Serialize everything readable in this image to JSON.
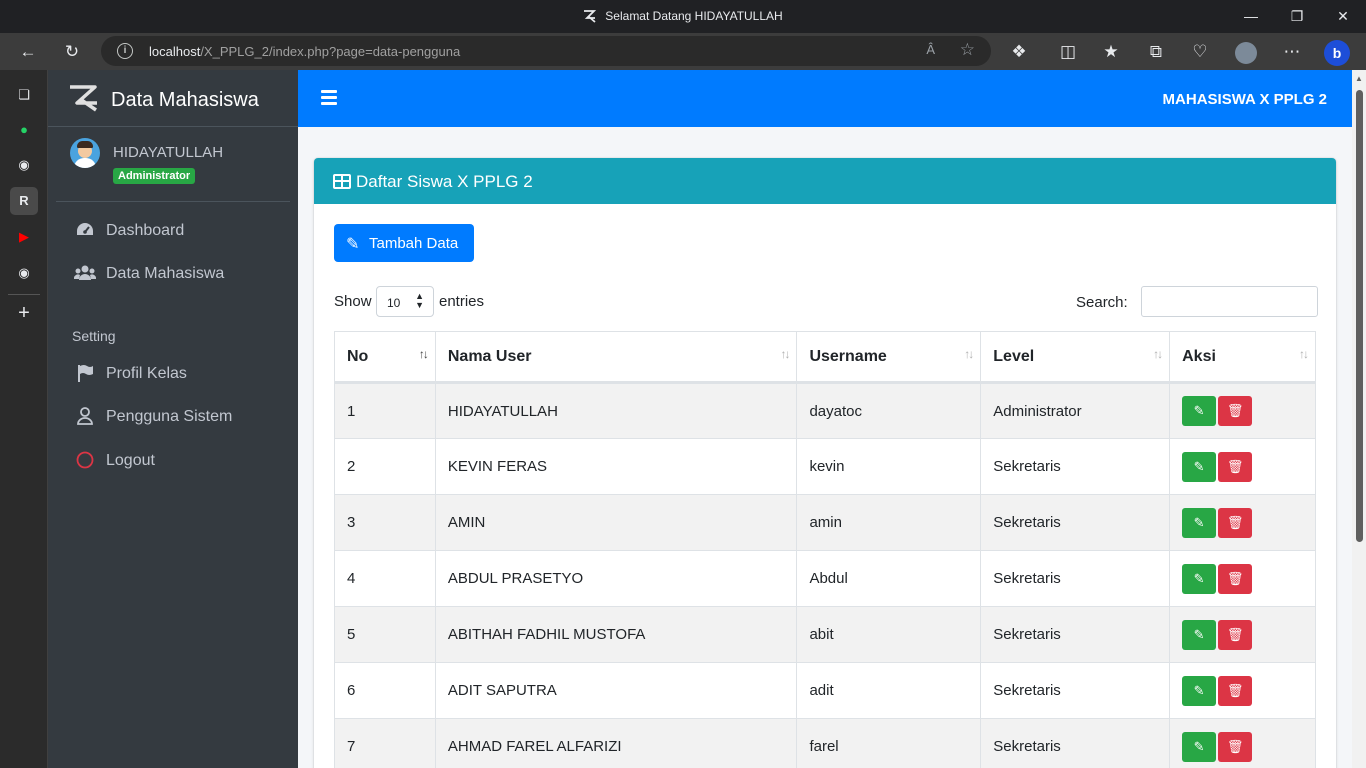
{
  "browser": {
    "window_title": "Selamat Datang HIDAYATULLAH",
    "url_host": "localhost",
    "url_path": "/X_PPLG_2/index.php?page=data-pengguna",
    "read_aloud": "Â"
  },
  "sidebar": {
    "brand": "Data Mahasiswa",
    "user": {
      "name": "HIDAYATULLAH",
      "role": "Administrator"
    },
    "items": [
      {
        "label": "Dashboard",
        "icon": "tachometer-icon"
      },
      {
        "label": "Data Mahasiswa",
        "icon": "users-icon"
      }
    ],
    "section_header": "Setting",
    "setting_items": [
      {
        "label": "Profil Kelas",
        "icon": "flag-icon"
      },
      {
        "label": "Pengguna Sistem",
        "icon": "user-icon"
      },
      {
        "label": "Logout",
        "icon": "power-icon"
      }
    ]
  },
  "navbar": {
    "title": "MAHASISWA X PPLG 2"
  },
  "card": {
    "title": "Daftar Siswa X PPLG 2",
    "add_button": "Tambah Data",
    "show_label": "Show",
    "entries_value": "10",
    "entries_label": "entries",
    "search_label": "Search:",
    "search_value": ""
  },
  "table": {
    "columns": [
      "No",
      "Nama User",
      "Username",
      "Level",
      "Aksi"
    ],
    "rows": [
      {
        "no": "1",
        "nama": "HIDAYATULLAH",
        "username": "dayatoc",
        "level": "Administrator"
      },
      {
        "no": "2",
        "nama": "KEVIN FERAS",
        "username": "kevin",
        "level": "Sekretaris"
      },
      {
        "no": "3",
        "nama": "AMIN",
        "username": "amin",
        "level": "Sekretaris"
      },
      {
        "no": "4",
        "nama": "ABDUL PRASETYO",
        "username": "Abdul",
        "level": "Sekretaris"
      },
      {
        "no": "5",
        "nama": "ABITHAH FADHIL MUSTOFA",
        "username": "abit",
        "level": "Sekretaris"
      },
      {
        "no": "6",
        "nama": "ADIT SAPUTRA",
        "username": "adit",
        "level": "Sekretaris"
      },
      {
        "no": "7",
        "nama": "AHMAD FAREL ALFARIZI",
        "username": "farel",
        "level": "Sekretaris"
      }
    ]
  },
  "colors": {
    "navbar": "#007bff",
    "card_header": "#17a2b8",
    "sidebar": "#343a40",
    "edit_button": "#28a745",
    "delete_button": "#dc3545",
    "role_badge": "#28a745"
  }
}
